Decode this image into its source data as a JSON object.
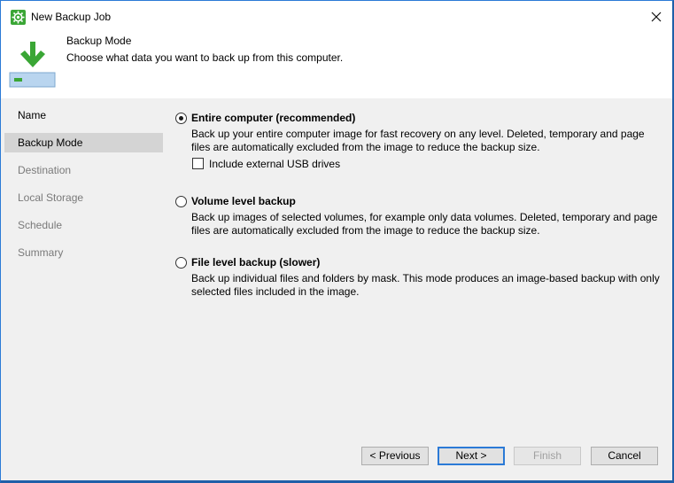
{
  "window": {
    "title": "New Backup Job"
  },
  "header": {
    "title": "Backup Mode",
    "subtitle": "Choose what data you want to back up from this computer."
  },
  "sidebar": {
    "items": [
      {
        "label": "Name",
        "state": "done"
      },
      {
        "label": "Backup Mode",
        "state": "active"
      },
      {
        "label": "Destination",
        "state": "pending"
      },
      {
        "label": "Local Storage",
        "state": "pending"
      },
      {
        "label": "Schedule",
        "state": "pending"
      },
      {
        "label": "Summary",
        "state": "pending"
      }
    ]
  },
  "options": {
    "entire": {
      "title": "Entire computer (recommended)",
      "desc_line1": "Back up your entire computer image for fast recovery on any level. Deleted, temporary and page",
      "desc_line2": "files are automatically excluded from the image to reduce the backup size.",
      "selected": true,
      "usb_label": "Include external USB drives",
      "usb_checked": false
    },
    "volume": {
      "title": "Volume level backup",
      "desc_line1": "Back up images of selected volumes, for example only data volumes. Deleted, temporary and page",
      "desc_line2": "files are automatically excluded from the image to reduce the backup size.",
      "selected": false
    },
    "file": {
      "title": "File level backup (slower)",
      "desc_line1": "Back up individual files and folders by mask. This mode produces an image-based backup with only",
      "desc_line2": "selected files included in the image.",
      "selected": false
    }
  },
  "footer": {
    "previous_label": "< Previous",
    "next_label": "Next >",
    "finish_label": "Finish",
    "cancel_label": "Cancel"
  },
  "colors": {
    "accent": "#2b7ad6",
    "app_icon_green": "#3aa635",
    "arrow_green": "#3aa635",
    "panel_bg": "#f0f0f0",
    "selected_nav_bg": "#d4d4d4"
  },
  "icons": {
    "app": "veeam-gear-icon",
    "close": "close-icon",
    "header": "download-to-drive-icon"
  }
}
